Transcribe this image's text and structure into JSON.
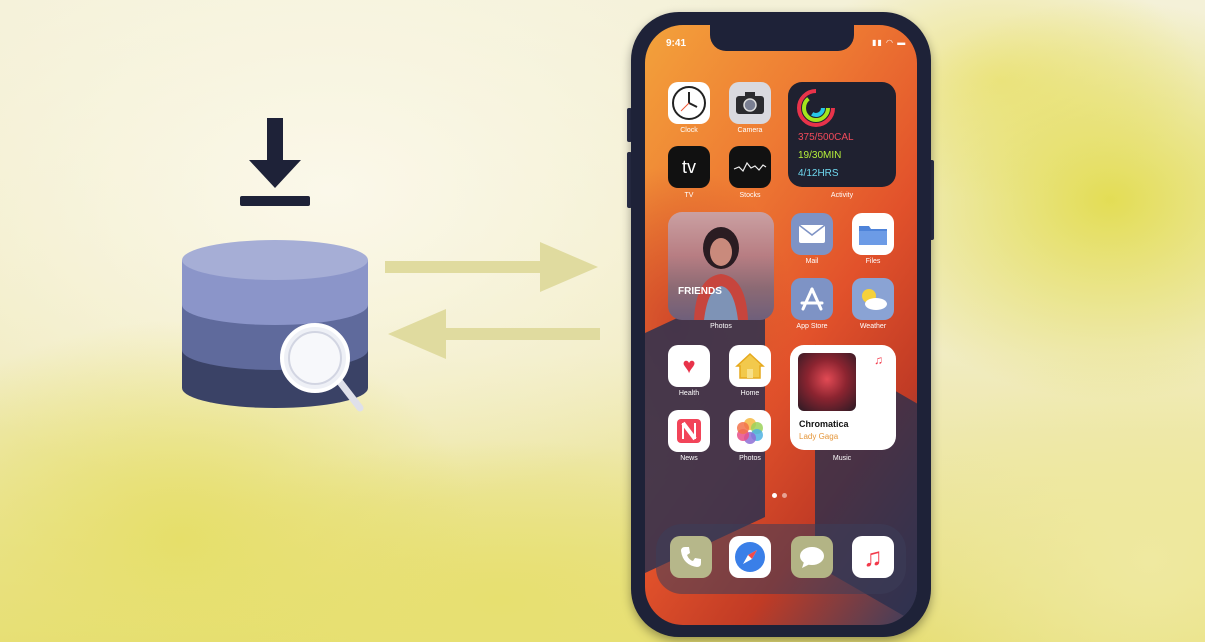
{
  "status": {
    "time": "9:41",
    "icons": "▮▮ ◠ ▬"
  },
  "apps": {
    "clock": "Clock",
    "camera": "Camera",
    "tv": "TV",
    "tv_glyph": "tv",
    "stocks": "Stocks",
    "activity": "Activity",
    "photos": "Photos",
    "mail": "Mail",
    "files": "Files",
    "appstore": "App Store",
    "weather": "Weather",
    "health": "Health",
    "home": "Home",
    "news": "News",
    "photos2": "Photos",
    "music": "Music"
  },
  "activity_widget": {
    "move": "375/500CAL",
    "exercise": "19/30MIN",
    "stand": "4/12HRS"
  },
  "photos_widget": {
    "caption": "FRIENDS"
  },
  "music_widget": {
    "album": "Chromatica",
    "artist": "Lady Gaga"
  },
  "colors": {
    "background": "#f1ecc2",
    "accent_yellow": "#e3dd55",
    "db_top": "#8b95c9",
    "db_mid": "#5f6a9c",
    "db_bottom": "#3a4266",
    "arrow": "#e0db9f",
    "phone_frame": "#1e2238"
  }
}
